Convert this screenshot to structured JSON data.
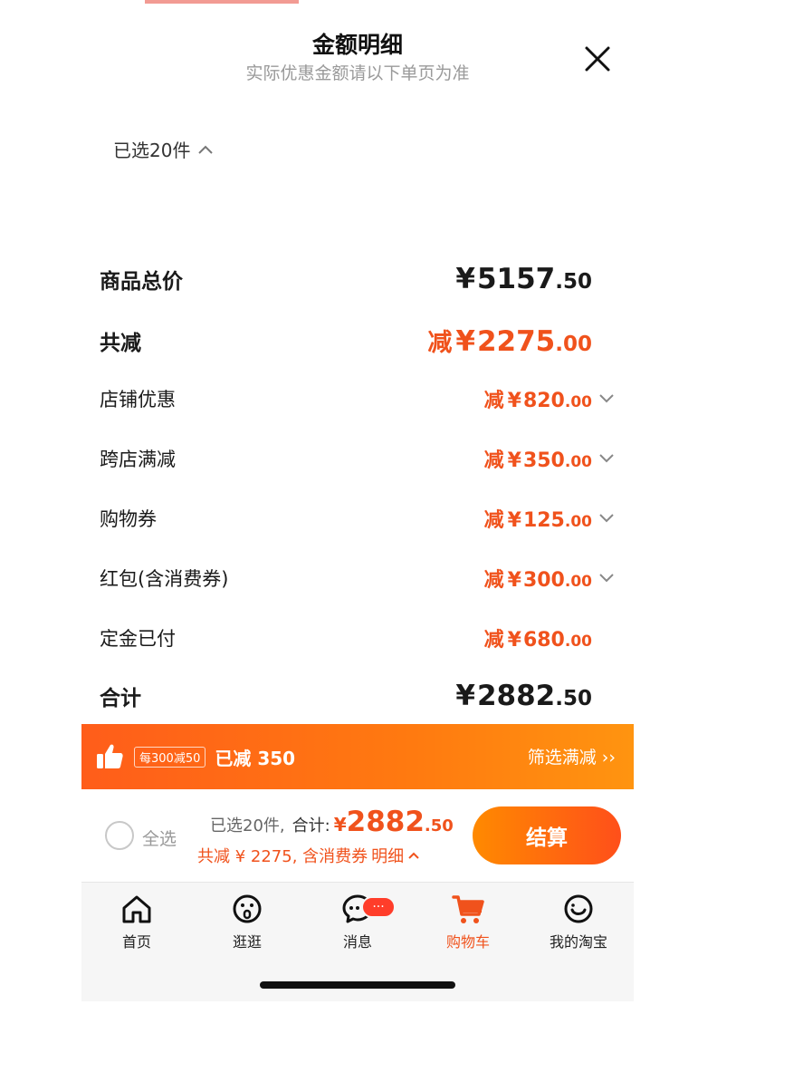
{
  "header": {
    "title": "金额明细",
    "subtitle": "实际优惠金额请以下单页为准",
    "close_icon": "close-icon"
  },
  "selection": {
    "label": "已选20件",
    "icon": "chevron-up-icon"
  },
  "summary": {
    "total_price": {
      "label": "商品总价",
      "yen": "¥",
      "int": "5157",
      "dec": ".50"
    },
    "total_reduce": {
      "label": "共减",
      "prefix": "减",
      "yen": "¥",
      "int": "2275",
      "dec": ".00"
    },
    "items": [
      {
        "label": "店铺优惠",
        "prefix": "减",
        "yen": "¥",
        "int": "820",
        "dec": ".00",
        "expandable": true
      },
      {
        "label": "跨店满减",
        "prefix": "减",
        "yen": "¥",
        "int": "350",
        "dec": ".00",
        "expandable": true
      },
      {
        "label": "购物券",
        "prefix": "减",
        "yen": "¥",
        "int": "125",
        "dec": ".00",
        "expandable": true
      },
      {
        "label": "红包(含消费券)",
        "prefix": "减",
        "yen": "¥",
        "int": "300",
        "dec": ".00",
        "expandable": true
      },
      {
        "label": "定金已付",
        "prefix": "减",
        "yen": "¥",
        "int": "680",
        "dec": ".00",
        "expandable": false
      }
    ],
    "grand_total": {
      "label": "合计",
      "yen": "¥",
      "int": "2882",
      "dec": ".50"
    }
  },
  "promo": {
    "icon": "thumbs-up-icon",
    "tag": "每300减50",
    "text": "已减 350",
    "link": "筛选满减 ››"
  },
  "checkout": {
    "select_all": "全选",
    "selected": "已选20件,",
    "total_label": "合计:",
    "yen": "¥",
    "int": "2882",
    "dec": ".50",
    "reduce_text": "共减 ¥ 2275, 含消费券",
    "detail_link": "明细",
    "pay_button": "结算"
  },
  "tabbar": {
    "tabs": [
      {
        "label": "首页",
        "icon": "home-icon"
      },
      {
        "label": "逛逛",
        "icon": "explore-icon"
      },
      {
        "label": "消息",
        "icon": "message-icon",
        "badge": "···"
      },
      {
        "label": "购物车",
        "icon": "cart-icon",
        "active": true
      },
      {
        "label": "我的淘宝",
        "icon": "profile-icon"
      }
    ]
  },
  "colors": {
    "accent": "#f0521c",
    "promo_gradient_start": "#ff5d1a",
    "promo_gradient_end": "#ff9410",
    "badge": "#ff3d2a"
  }
}
